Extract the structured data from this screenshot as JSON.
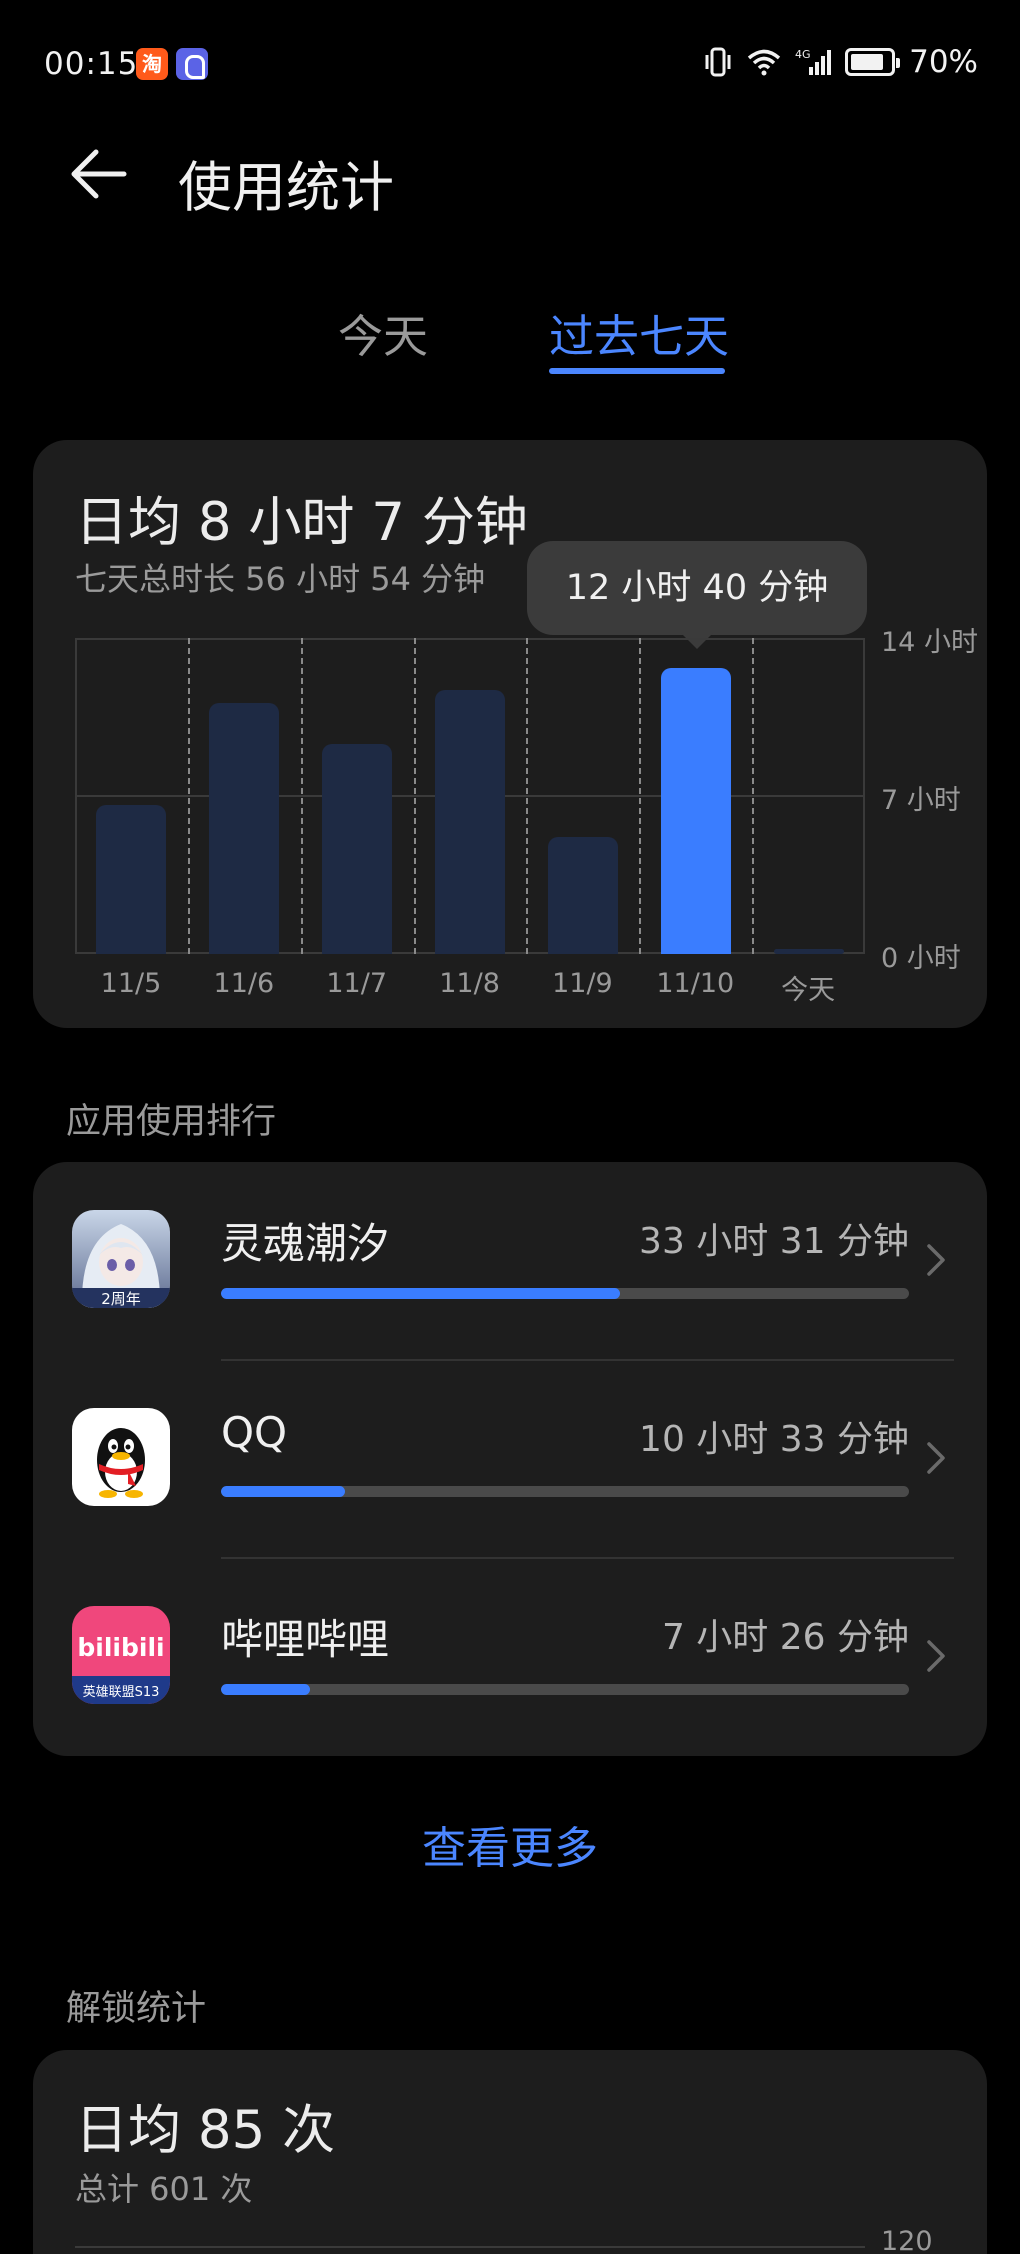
{
  "status_bar": {
    "time": "00:15",
    "battery_pct": "70%",
    "notif_apps": [
      "taobao-icon",
      "shield-app-icon"
    ],
    "indicators": [
      "vibrate-icon",
      "wifi-icon",
      "4g-signal-icon",
      "battery-saver-icon"
    ]
  },
  "header": {
    "title": "使用统计",
    "back_icon": "arrow-left-icon"
  },
  "tabs": [
    {
      "label": "今天",
      "selected": false
    },
    {
      "label": "过去七天",
      "selected": true
    }
  ],
  "usage_card": {
    "daily_avg": "日均  8 小时 7 分钟",
    "total": "七天总时长  56 小时 54 分钟",
    "tooltip": "12 小时 40 分钟"
  },
  "chart_data": {
    "type": "bar",
    "categories": [
      "11/5",
      "11/6",
      "11/7",
      "11/8",
      "11/9",
      "11/10",
      "今天"
    ],
    "values": [
      6.6,
      11.1,
      9.3,
      11.7,
      5.2,
      12.67,
      0.2
    ],
    "y_ticks": [
      "14 小时",
      "7 小时",
      "0 小时"
    ],
    "ylim": [
      0,
      14
    ],
    "highlighted_index": 5,
    "colors": {
      "active": "#3a7dff",
      "inactive": "#1e2a44"
    }
  },
  "app_ranking": {
    "section_title": "应用使用排行",
    "items": [
      {
        "name": "灵魂潮汐",
        "time": "33 小时 31 分钟",
        "fraction": 0.58,
        "icon": "soul-tide-app-icon",
        "icon_badge": "2周年"
      },
      {
        "name": "QQ",
        "time": "10 小时 33 分钟",
        "fraction": 0.18,
        "icon": "qq-penguin-icon"
      },
      {
        "name": "哔哩哔哩",
        "time": "7 小时 26 分钟",
        "fraction": 0.13,
        "icon": "bilibili-icon",
        "icon_logo": "bilibili",
        "icon_badge": "英雄联盟S13"
      }
    ],
    "see_more": "查看更多"
  },
  "unlock_stats": {
    "section_title": "解锁统计",
    "daily_avg": "日均  85 次",
    "total": "总计  601 次",
    "y_top": "120"
  }
}
